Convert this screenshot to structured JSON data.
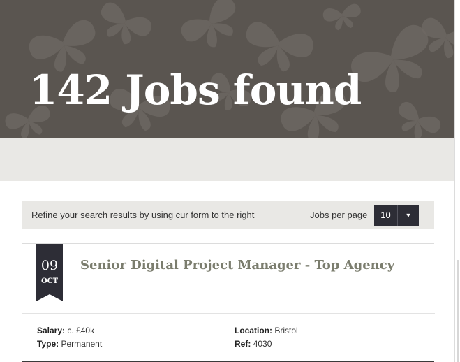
{
  "hero": {
    "title": "142 Jobs found"
  },
  "filter_bar": {
    "refine_text": "Refine your search results by using cur form to the right",
    "jobs_per_page_label": "Jobs per page",
    "jobs_per_page_value": "10",
    "caret_icon": "chevron-down-icon"
  },
  "job": {
    "day": "09",
    "month": "OCT",
    "title": "Senior Digital Project Manager - Top Agency",
    "salary_label": "Salary:",
    "salary_value": "c. £40k",
    "type_label": "Type:",
    "type_value": "Permanent",
    "location_label": "Location:",
    "location_value": "Bristol",
    "ref_label": "Ref:",
    "ref_value": "4030"
  },
  "colors": {
    "hero_bg": "#5a5550",
    "band_bg": "#e9e8e5",
    "ribbon": "#2d2d36",
    "title_link": "#7b7d6e"
  }
}
